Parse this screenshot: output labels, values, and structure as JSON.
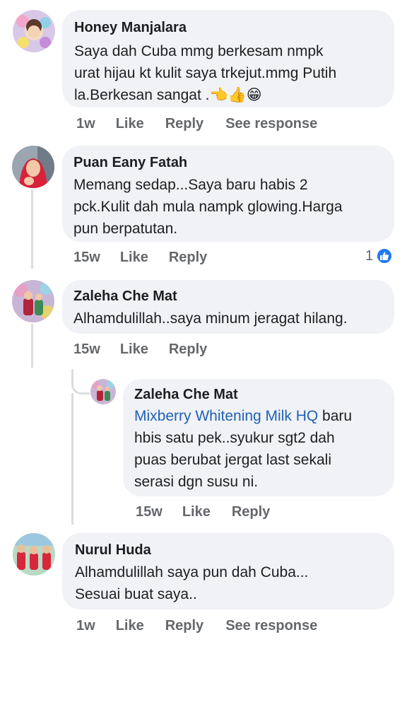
{
  "comments": [
    {
      "author": "Honey Manjalara",
      "lines": [
        "Saya dah Cuba mmg berkesam nmpk",
        "urat hijau kt kulit saya trkejut.mmg Putih",
        "la.Berkesan sangat .👈👍😁"
      ],
      "time": "1w",
      "like": "Like",
      "reply": "Reply",
      "see_response": "See response"
    },
    {
      "author": "Puan Eany Fatah",
      "lines": [
        "Memang sedap...Saya baru habis 2",
        "pck.Kulit dah mula nampk glowing.Harga",
        "pun berpatutan."
      ],
      "time": "15w",
      "like": "Like",
      "reply": "Reply",
      "reaction_count": "1"
    },
    {
      "author": "Zaleha Che Mat",
      "lines": [
        "Alhamdulillah..saya minum jeragat hilang."
      ],
      "time": "15w",
      "like": "Like",
      "reply": "Reply"
    },
    {
      "author": "Zaleha Che Mat",
      "mention": "Mixberry Whitening Milk HQ",
      "first_line_rest": " baru",
      "lines": [
        "hbis satu pek..syukur sgt2 dah",
        "puas berubat jergat last sekali",
        "serasi dgn susu ni."
      ],
      "time": "15w",
      "like": "Like",
      "reply": "Reply"
    },
    {
      "author": "Nurul Huda",
      "lines": [
        "Alhamdulillah saya pun dah Cuba...",
        "Sesuai buat saya.."
      ],
      "time": "1w",
      "like": "Like",
      "reply": "Reply",
      "see_response": "See response"
    }
  ],
  "icons": {
    "reaction": "like-reaction-icon"
  },
  "colors": {
    "bubble": "#f0f2f5",
    "mention": "#2061b5",
    "like_badge": "#2078f4",
    "meta_text": "#65676b"
  }
}
